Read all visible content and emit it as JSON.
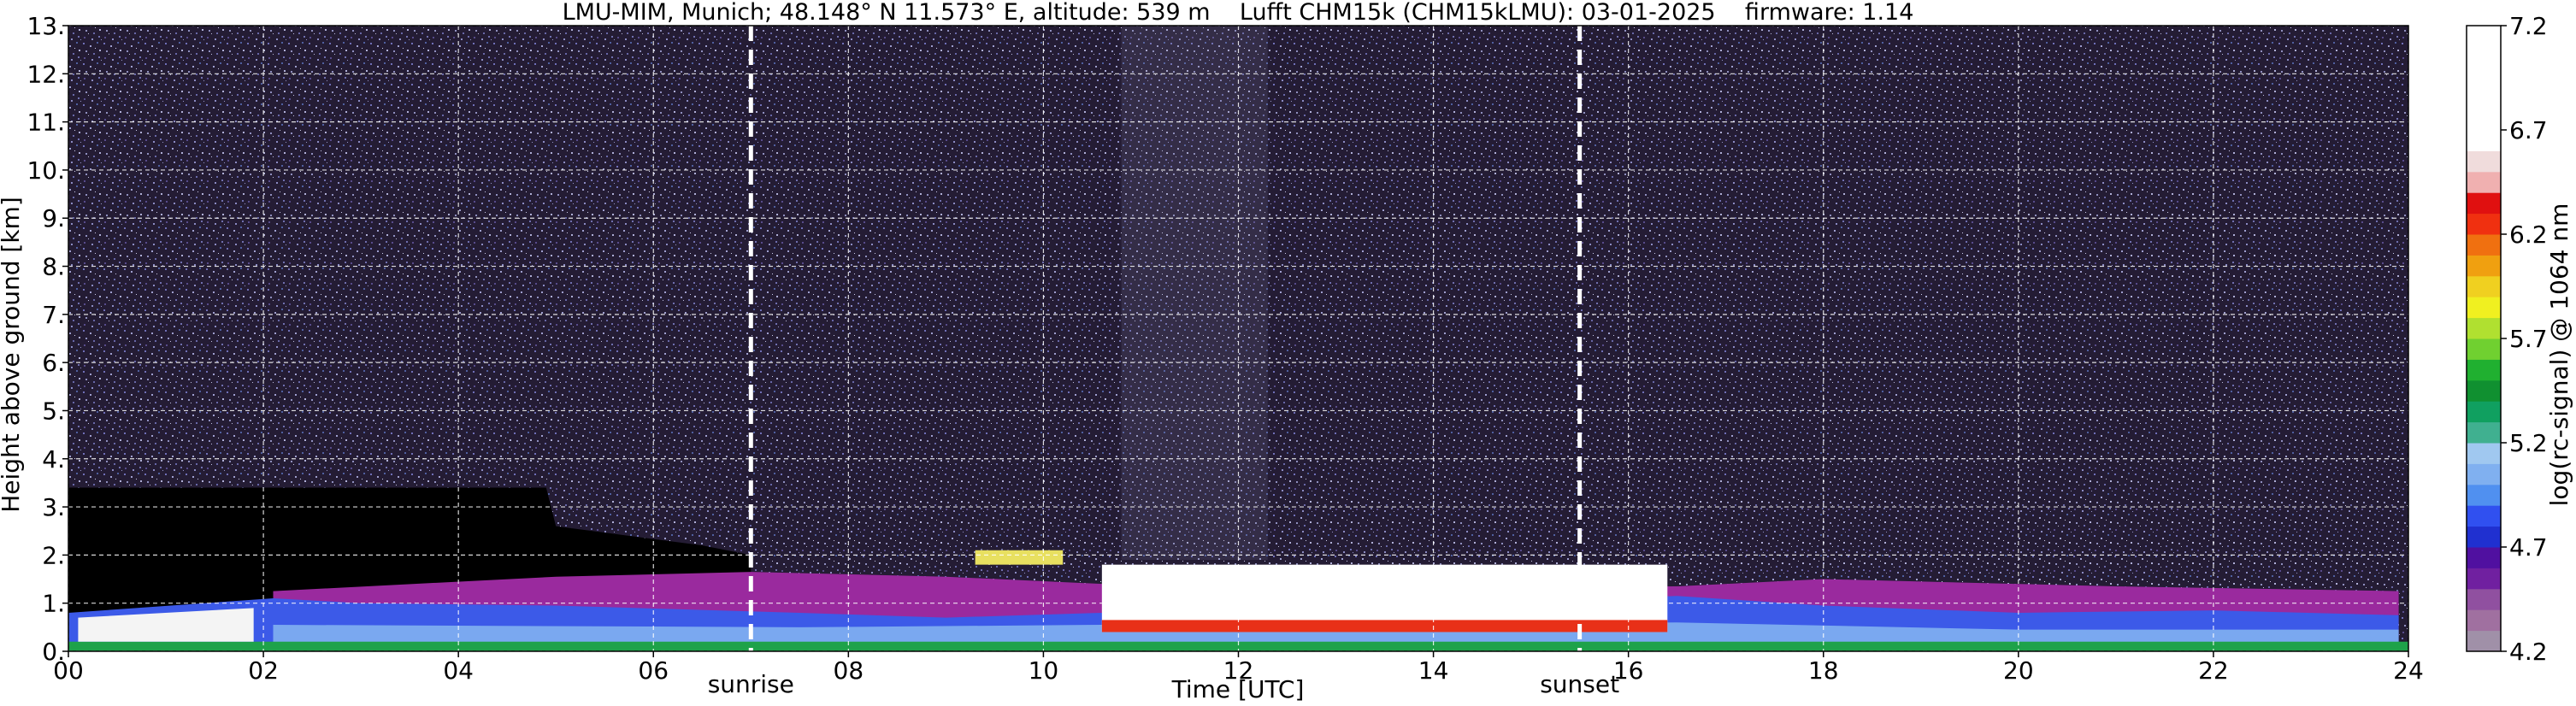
{
  "chart_data": {
    "type": "heatmap",
    "title": "LMU-MIM, Munich; 48.148° N 11.573° E, altitude: 539 m    Lufft CHM15k (CHM15kLMU): 03-01-2025    firmware: 1.14",
    "xlabel": "Time [UTC]",
    "ylabel": "Height above ground [km]",
    "colorbar_label": "log(rc-signal) @ 1064 nm",
    "xlim": [
      0,
      24
    ],
    "ylim": [
      0,
      13
    ],
    "x_ticks": [
      "00",
      "02",
      "04",
      "06",
      "08",
      "10",
      "12",
      "14",
      "16",
      "18",
      "20",
      "22",
      "24"
    ],
    "x_tick_values": [
      0,
      2,
      4,
      6,
      8,
      10,
      12,
      14,
      16,
      18,
      20,
      22,
      24
    ],
    "y_ticks": [
      "0.",
      "1.",
      "2.",
      "3.",
      "4.",
      "5.",
      "6.",
      "7.",
      "8.",
      "9.",
      "10.",
      "11.",
      "12.",
      "13."
    ],
    "y_tick_values": [
      0,
      1,
      2,
      3,
      4,
      5,
      6,
      7,
      8,
      9,
      10,
      11,
      12,
      13
    ],
    "colorbar_range": [
      4.2,
      7.2
    ],
    "colorbar_ticks": [
      "4.2",
      "4.7",
      "5.2",
      "5.7",
      "6.2",
      "6.7",
      "7.2"
    ],
    "colorbar_tick_values": [
      4.2,
      4.7,
      5.2,
      5.7,
      6.2,
      6.7,
      7.2
    ],
    "colorbar_colors": [
      "#a090a8",
      "#a070a0",
      "#9050a0",
      "#7020a0",
      "#5010a0",
      "#2030d0",
      "#3050f0",
      "#5090f0",
      "#80b0f0",
      "#a0c8f0",
      "#40b090",
      "#10a060",
      "#109030",
      "#20b030",
      "#70d030",
      "#b0e030",
      "#f0f020",
      "#f0d020",
      "#f0a010",
      "#f07010",
      "#f03010",
      "#e01010",
      "#f0b0b0",
      "#f0dcdc",
      "#ffffff",
      "#ffffff",
      "#ffffff",
      "#ffffff",
      "#ffffff",
      "#ffffff"
    ],
    "events": [
      {
        "label": "sunrise",
        "time": 7.0
      },
      {
        "label": "sunset",
        "time": 15.5
      }
    ],
    "grid": true,
    "layers": [
      {
        "name": "boundary layer",
        "t_start": 0.0,
        "t_end": 24.0,
        "height_top": 1.1
      },
      {
        "name": "cloud",
        "t_start": 10.6,
        "t_end": 16.4,
        "height_bottom": 0.4,
        "height_top": 1.8
      },
      {
        "name": "elevated aerosol",
        "t_start": 9.3,
        "t_end": 10.2,
        "height_bottom": 1.8,
        "height_top": 2.1
      }
    ]
  }
}
